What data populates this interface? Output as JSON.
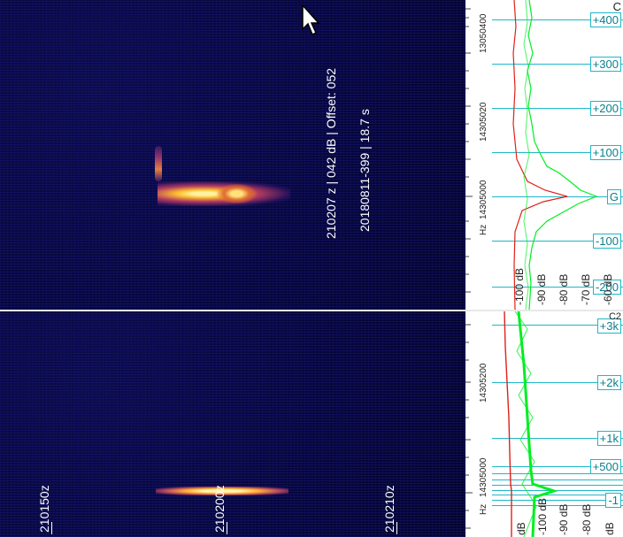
{
  "top_panel": {
    "info_line1": "210207 z |  042 dB | Offset: 052",
    "info_line2": "20180811-399  |  18.7 s",
    "freq_labels": [
      "13050400",
      "14305020",
      "14305000",
      "Hz"
    ],
    "right_tags": [
      "+400",
      "+300",
      "+200",
      "+100",
      "G",
      "-100",
      "-200"
    ],
    "db_labels": [
      "-100 dB",
      "-90 dB",
      "-80 dB",
      "-70 dB",
      "-60 dB"
    ],
    "corner_letter": "C"
  },
  "bottom_panel": {
    "freq_labels": [
      "14305200",
      "14305000",
      "Hz"
    ],
    "right_tags": [
      "+3k",
      "+2k",
      "+1k",
      "+500",
      "-1"
    ],
    "db_labels": [
      "dB",
      "-100 dB",
      "-90 dB",
      "-80 dB",
      "dB"
    ],
    "time_labels": [
      "210150z",
      "210200z",
      "210210z"
    ],
    "corner_letter": "C2"
  },
  "colors": {
    "waterfall_bg": "#06063a",
    "signal_hot": "#ffd24a",
    "grid_cyan": "#1fb7c7",
    "trace_green": "#00ff2a",
    "trace_red": "#e0201a"
  },
  "icons": [
    "mouse-cursor-icon"
  ]
}
